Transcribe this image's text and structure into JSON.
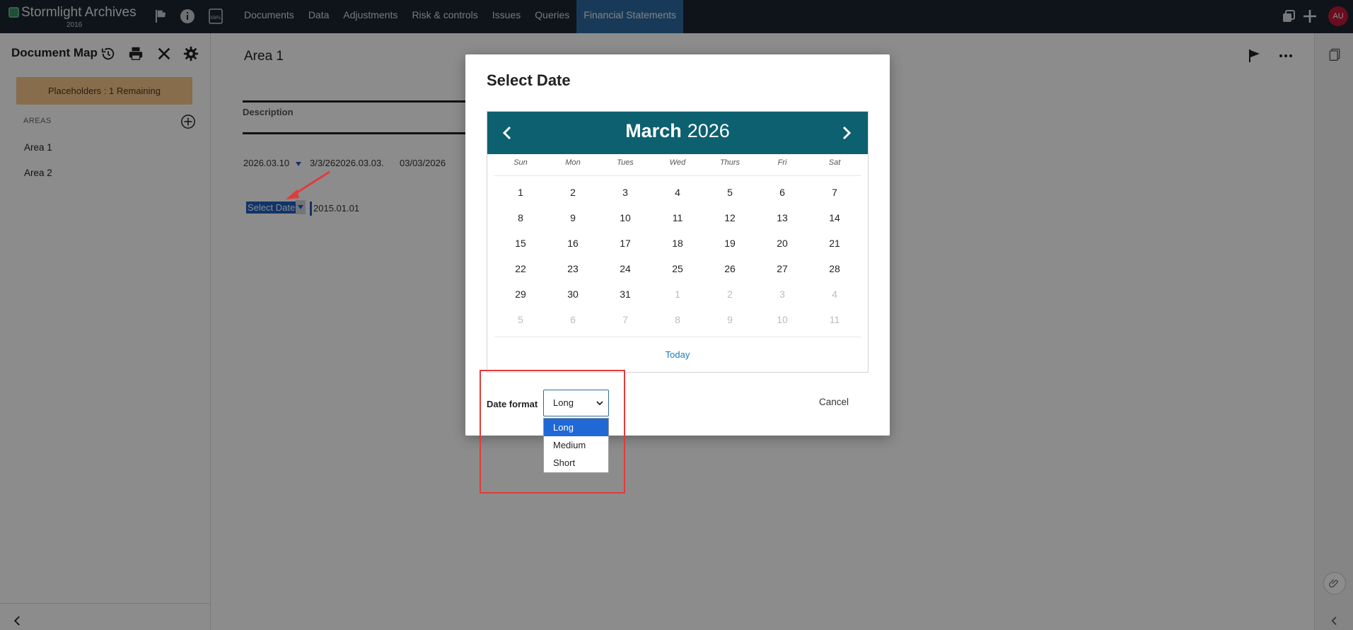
{
  "topbar": {
    "app_name": "Stormlight Archives",
    "app_year": "2016",
    "nav": [
      "Documents",
      "Data",
      "Adjustments",
      "Risk & controls",
      "Issues",
      "Queries",
      "Financial Statements"
    ],
    "active_nav": "Financial Statements",
    "avatar_initials": "AU",
    "icons": [
      "flag-icon",
      "info-icon",
      "xbrl-icon",
      "copy-icon",
      "plus-icon"
    ]
  },
  "sidebar": {
    "title": "Document Map",
    "placeholder_text": "Placeholders : 1 Remaining",
    "areas_label": "AREAS",
    "areas": [
      "Area 1",
      "Area 2"
    ],
    "icons": [
      "history-icon",
      "print-icon",
      "tools-icon",
      "gear-icon",
      "add-circle-icon",
      "chevron-left-icon"
    ]
  },
  "main": {
    "title": "Area 1",
    "description_header": "Description",
    "date_values": [
      "2026.03.10",
      "3/3/262026.03.03.",
      "03/03/2026"
    ],
    "select_date_label": "Select Date",
    "select_date_value": "2015.01.01"
  },
  "modal": {
    "title": "Select Date",
    "calendar": {
      "month": "March",
      "year": "2026",
      "weekdays": [
        "Sun",
        "Mon",
        "Tues",
        "Wed",
        "Thurs",
        "Fri",
        "Sat"
      ],
      "weeks": [
        [
          "1",
          "2",
          "3",
          "4",
          "5",
          "6",
          "7"
        ],
        [
          "8",
          "9",
          "10",
          "11",
          "12",
          "13",
          "14"
        ],
        [
          "15",
          "16",
          "17",
          "18",
          "19",
          "20",
          "21"
        ],
        [
          "22",
          "23",
          "24",
          "25",
          "26",
          "27",
          "28"
        ],
        [
          "29",
          "30",
          "31",
          "1",
          "2",
          "3",
          "4"
        ],
        [
          "5",
          "6",
          "7",
          "8",
          "9",
          "10",
          "11"
        ]
      ],
      "muted_from_index": 31,
      "today_label": "Today"
    },
    "date_format_label": "Date format",
    "date_format_value": "Long",
    "date_format_options": [
      "Long",
      "Medium",
      "Short"
    ],
    "cancel_label": "Cancel"
  },
  "colors": {
    "topbar": "#1d2530",
    "active_nav": "#2d6aa0",
    "calendar_header": "#0d6070",
    "placeholder_badge": "#f6c68a",
    "highlight": "#e23b3b"
  }
}
